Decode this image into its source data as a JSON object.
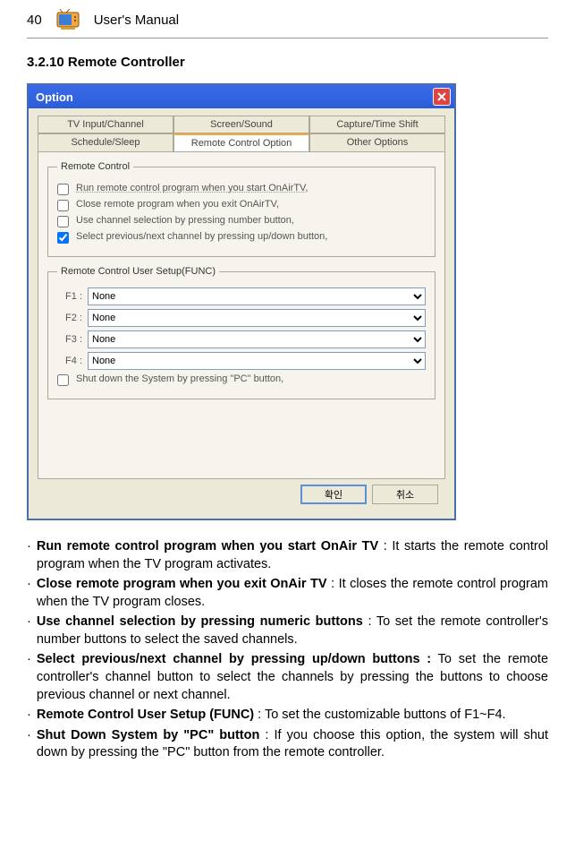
{
  "header": {
    "page_num": "40",
    "manual": "User's Manual"
  },
  "section": {
    "title": "3.2.10 Remote Controller"
  },
  "dialog": {
    "title": "Option",
    "tabs_row1": [
      "TV Input/Channel",
      "Screen/Sound",
      "Capture/Time Shift"
    ],
    "tabs_row2": [
      "Schedule/Sleep",
      "Remote Control Option",
      "Other Options"
    ],
    "active_tab": "Remote Control Option",
    "remote_control": {
      "legend": "Remote Control",
      "opts": [
        {
          "label": "Run remote control program when you start OnAirTV,",
          "checked": false,
          "dotted": true
        },
        {
          "label": "Close remote program when you exit OnAirTV,",
          "checked": false
        },
        {
          "label": "Use channel selection by pressing number button,",
          "checked": false
        },
        {
          "label": "Select previous/next channel by pressing up/down button,",
          "checked": true
        }
      ]
    },
    "func": {
      "legend": "Remote Control User Setup(FUNC)",
      "rows": [
        {
          "label": "F1 :",
          "value": "None"
        },
        {
          "label": "F2 :",
          "value": "None"
        },
        {
          "label": "F3 :",
          "value": "None"
        },
        {
          "label": "F4 :",
          "value": "None"
        }
      ],
      "shutdown": {
        "label": "Shut down the System by pressing \"PC\" button,",
        "checked": false
      }
    },
    "buttons": {
      "ok": "확인",
      "cancel": "취소"
    }
  },
  "bullets": [
    {
      "bold": "Run remote control program when you start OnAir TV",
      "text": " : It starts the remote control program when the TV program activates."
    },
    {
      "bold": "Close remote program when you exit OnAir TV",
      "text": " : It closes the remote control program when the TV program closes."
    },
    {
      "bold": "Use channel selection by pressing numeric buttons",
      "text": " : To set the remote controller's number buttons to select the saved channels."
    },
    {
      "bold": "Select previous/next channel by pressing up/down buttons :",
      "text": "   To set the remote controller's channel button to select the channels by pressing the buttons to choose previous channel or next channel."
    },
    {
      "bold": "Remote Control User Setup (FUNC)",
      "text": " : To set the customizable buttons of F1~F4."
    },
    {
      "bold": "Shut Down System by \"PC\" button",
      "text": " : If you choose this option, the system will shut down by pressing the \"PC\" button from the remote controller."
    }
  ]
}
